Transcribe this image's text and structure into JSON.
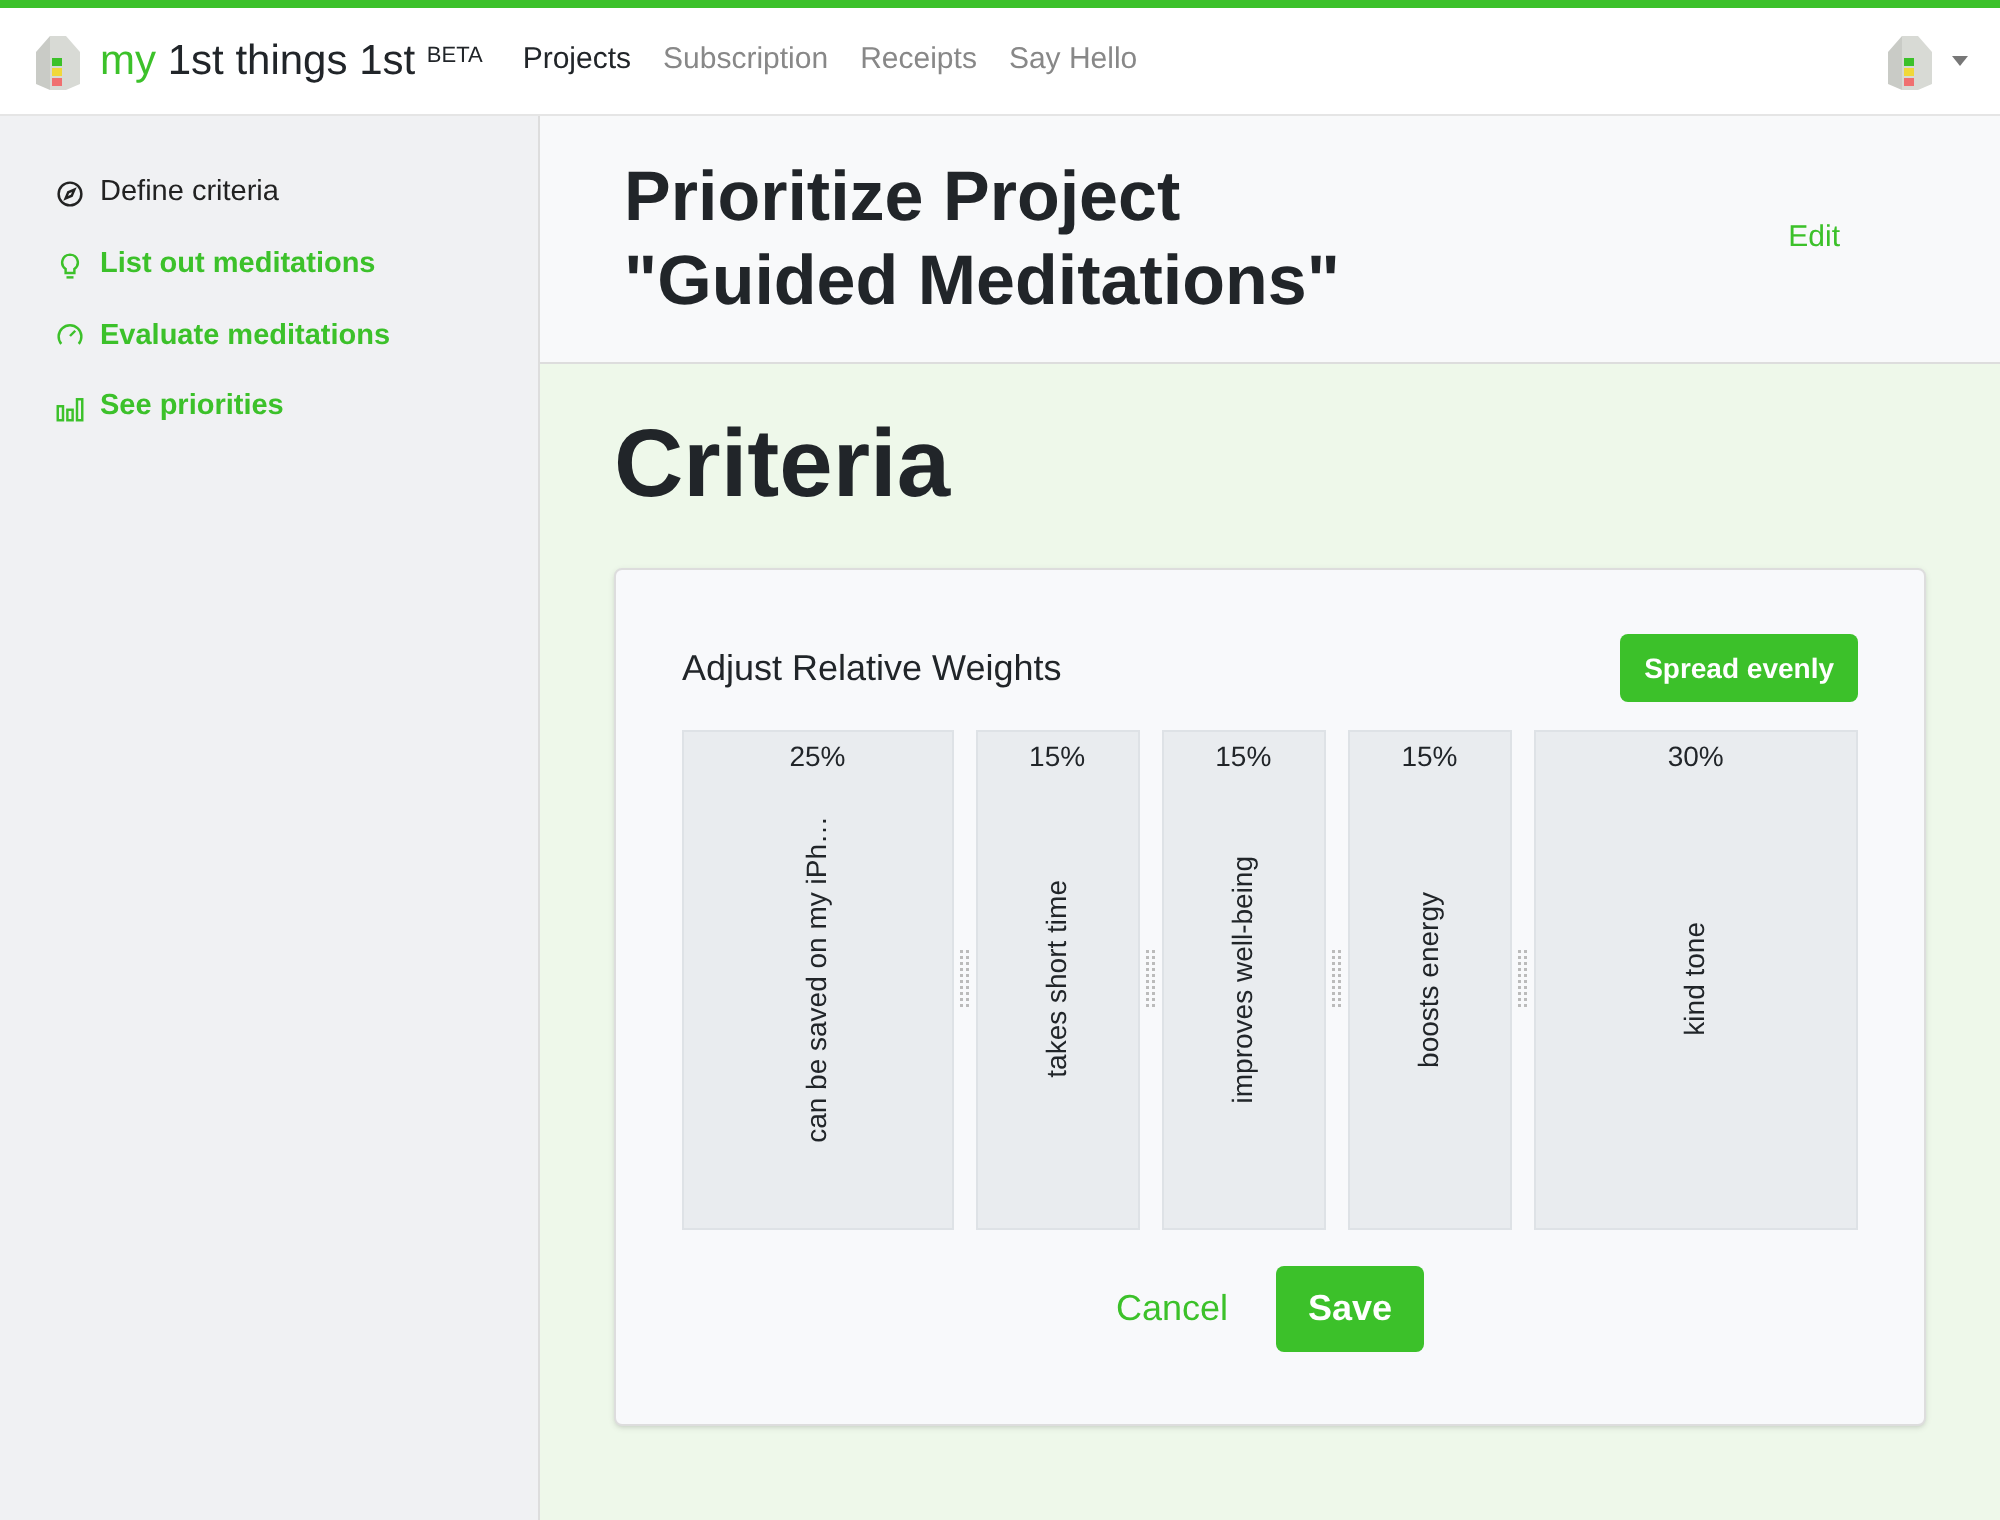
{
  "brand": {
    "prefix": "my",
    "name": "1st things 1st",
    "badge": "BETA"
  },
  "nav": [
    {
      "label": "Projects",
      "selected": true
    },
    {
      "label": "Subscription",
      "selected": false
    },
    {
      "label": "Receipts",
      "selected": false
    },
    {
      "label": "Say Hello",
      "selected": false
    }
  ],
  "sidebar": {
    "items": [
      {
        "kind": "compass",
        "label": "Define criteria",
        "selected": true
      },
      {
        "kind": "bulb",
        "label": "List out meditations",
        "selected": false
      },
      {
        "kind": "gauge",
        "label": "Evaluate meditations",
        "selected": false
      },
      {
        "kind": "chart",
        "label": "See priorities",
        "selected": false
      }
    ]
  },
  "header": {
    "title_line_1": "Prioritize Project",
    "title_line_2": "\"Guided Meditations\"",
    "edit": "Edit"
  },
  "section_title": "Criteria",
  "card": {
    "title": "Adjust Relative Weights",
    "spread_button": "Spread evenly",
    "weights": [
      {
        "percent": "25%",
        "label": "can be saved on my iPh…"
      },
      {
        "percent": "15%",
        "label": "takes short time"
      },
      {
        "percent": "15%",
        "label": "improves well-being"
      },
      {
        "percent": "15%",
        "label": "boosts energy"
      },
      {
        "percent": "30%",
        "label": "kind tone"
      }
    ],
    "cancel": "Cancel",
    "save": "Save"
  }
}
